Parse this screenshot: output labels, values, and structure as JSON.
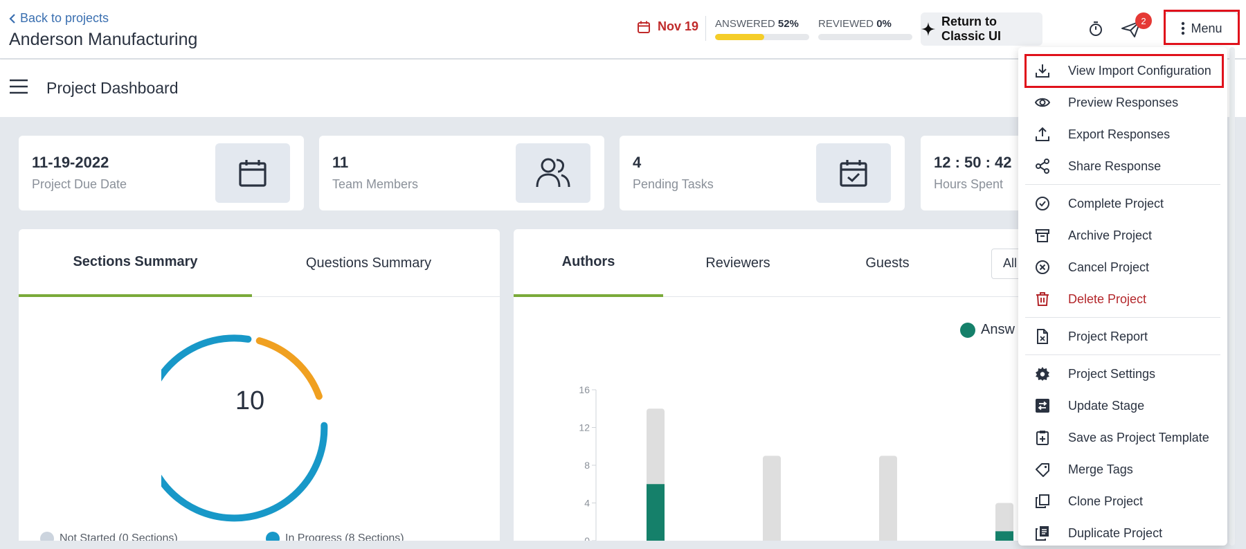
{
  "header": {
    "back_label": "Back to projects",
    "project_name": "Anderson Manufacturing",
    "due_label": "Nov 19",
    "answered": {
      "label": "ANSWERED",
      "value": "52%",
      "fraction": 0.52
    },
    "reviewed": {
      "label": "REVIEWED",
      "value": "0%",
      "fraction": 0.0
    },
    "classic_ui_label": "Return to Classic UI",
    "notification_count": "2",
    "menu_label": "Menu",
    "icons": [
      "chevron-left-icon",
      "calendar-icon",
      "sparkle-icon",
      "timer-icon",
      "paper-plane-icon",
      "kebab-icon"
    ],
    "accent_colors": {
      "due": "#c02a2a",
      "progress": "#f5cd28",
      "badge": "#e53935",
      "highlight": "#e0111b"
    }
  },
  "subheader": {
    "title": "Project Dashboard"
  },
  "stats": [
    {
      "value": "11-19-2022",
      "label": "Project Due Date",
      "icon": "calendar-icon"
    },
    {
      "value": "11",
      "label": "Team Members",
      "icon": "users-icon"
    },
    {
      "value": "4",
      "label": "Pending Tasks",
      "icon": "calendar-check-icon"
    },
    {
      "value": "12 : 50 : 42",
      "label": "Hours Spent",
      "icon": ""
    }
  ],
  "sections_panel": {
    "tabs": [
      "Sections Summary",
      "Questions Summary"
    ],
    "active_tab": 0,
    "donut_total": "10",
    "donut_colors": {
      "in_progress": "#1898c8",
      "other": "#f0a020"
    },
    "legend": [
      "Not Started (0 Sections)",
      "In Progress (8 Sections)"
    ]
  },
  "people_panel": {
    "tabs": [
      "Authors",
      "Reviewers",
      "Guests"
    ],
    "active_tab": 0,
    "filter_value": "All",
    "legend_label": "Answ",
    "colors": {
      "answered": "#15806a",
      "total": "#dedede"
    }
  },
  "chart_data": {
    "type": "bar",
    "ylim": [
      0,
      16
    ],
    "yticks": [
      "16",
      "12",
      "8",
      "4",
      "0"
    ],
    "series": [
      {
        "name": "Answ",
        "values": [
          6,
          0,
          0,
          1
        ]
      },
      {
        "values": [
          14,
          9,
          9,
          4
        ]
      }
    ]
  },
  "menu": {
    "items": [
      {
        "label": "View Import Configuration",
        "icon": "download-icon",
        "highlighted": true
      },
      {
        "label": "Preview Responses",
        "icon": "eye-icon"
      },
      {
        "label": "Export Responses",
        "icon": "upload-icon"
      },
      {
        "label": "Share Response",
        "icon": "share-icon"
      },
      {
        "label": "Complete Project",
        "icon": "check-circle-icon"
      },
      {
        "label": "Archive Project",
        "icon": "archive-icon"
      },
      {
        "label": "Cancel Project",
        "icon": "x-circle-icon"
      },
      {
        "label": "Delete Project",
        "icon": "trash-icon",
        "danger": true
      },
      {
        "label": "Project Report",
        "icon": "file-report-icon"
      },
      {
        "label": "Project Settings",
        "icon": "gear-icon"
      },
      {
        "label": "Update Stage",
        "icon": "swap-icon"
      },
      {
        "label": "Save as Project Template",
        "icon": "clipboard-plus-icon"
      },
      {
        "label": "Merge Tags",
        "icon": "tag-icon"
      },
      {
        "label": "Clone Project",
        "icon": "copy-icon"
      },
      {
        "label": "Duplicate Project",
        "icon": "duplicate-icon"
      }
    ]
  }
}
